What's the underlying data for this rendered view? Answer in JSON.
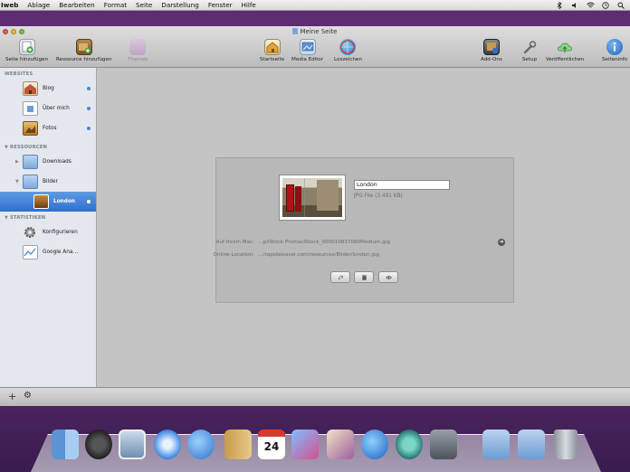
{
  "menubar": {
    "items": [
      "Iweb",
      "Ablage",
      "Bearbeiten",
      "Format",
      "Seite",
      "Darstellung",
      "Fenster",
      "Hilfe"
    ]
  },
  "window": {
    "title": "Meine Seite"
  },
  "toolbar": {
    "add_page": "Seite hinzufügen",
    "add_resource": "Ressource hinzufügen",
    "themes": "Themes",
    "homepage": "Startseite",
    "media_editor": "Media Editor",
    "source": "Loszeichen",
    "add_ons": "Add-Ons",
    "setup": "Setup",
    "publish": "Veröffentlichen",
    "page_info": "Seiteninfo"
  },
  "sidebar": {
    "sections": {
      "websites": "WEBSITES",
      "resources": "RESSOURCEN",
      "statistics": "STATISTIKEN"
    },
    "websites": [
      "Blog",
      "Über mich",
      "Fotos"
    ],
    "resources": [
      "Downloads",
      "Bilder",
      "London"
    ],
    "statistics": [
      "Konfigurieren",
      "Google Ana…"
    ]
  },
  "detail": {
    "name_value": "London",
    "file_info": "JPG File (3.491 KB)",
    "path_label": "Auf Ihrem Mac:",
    "path_value": "…p/iStock Photos/iStock_000010837090Medium.jpg",
    "online_label": "Online-Location:",
    "online_value": "…/rapidweaver.com/resources/Bilder/london.jpg"
  },
  "bottombar": {
    "add": "+",
    "action": "⚙"
  },
  "dock": {
    "icons": [
      "finder-icon",
      "dashboard-icon",
      "preview-icon",
      "safari-icon",
      "ichat-icon",
      "address-book-icon",
      "ical-icon",
      "iphoto-icon",
      "iweb-icon",
      "itunes-icon",
      "time-machine-icon",
      "system-preferences-icon",
      "folder-icon",
      "folder-icon",
      "trash-icon"
    ],
    "ical_day": "24"
  }
}
